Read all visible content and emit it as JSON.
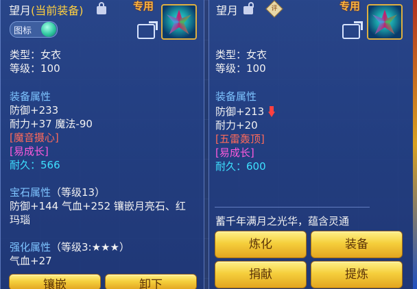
{
  "left": {
    "title_name": "望月",
    "title_status": "(当前装备)",
    "exclusive_tag": "专用",
    "icon_toggle_label": "图标",
    "type_line": "类型：女衣",
    "level_line": "等级：100",
    "equip_attr_header": "装备属性",
    "defense": "防御+233",
    "stamina_magic": "耐力+37 魔法-90",
    "effect1": "[魔音摄心]",
    "effect2": "[易成长]",
    "durability": "耐久：566",
    "gem_header": "宝石属性",
    "gem_level": "（等级13）",
    "gem_line1": "防御+144 气血+252 镶嵌月亮石、红",
    "gem_line2": "玛瑙",
    "forge_header": "强化属性",
    "forge_level": "（等级3:★★★）",
    "forge_line1": "气血+27",
    "btn_inlay": "镶嵌",
    "btn_unequip": "卸下"
  },
  "right": {
    "title_name": "望月",
    "exclusive_tag": "专用",
    "diamond_label": "评",
    "type_line": "类型：女衣",
    "level_line": "等级：100",
    "equip_attr_header": "装备属性",
    "defense": "防御+213",
    "stamina": "耐力+20",
    "effect1": "[五雷轰顶]",
    "effect2": "[易成长]",
    "durability": "耐久：600",
    "description": "蓄千年满月之光华，蕴含灵通",
    "btn_refine": "炼化",
    "btn_equip": "装备",
    "btn_donate": "捐献",
    "btn_purify": "提炼"
  }
}
